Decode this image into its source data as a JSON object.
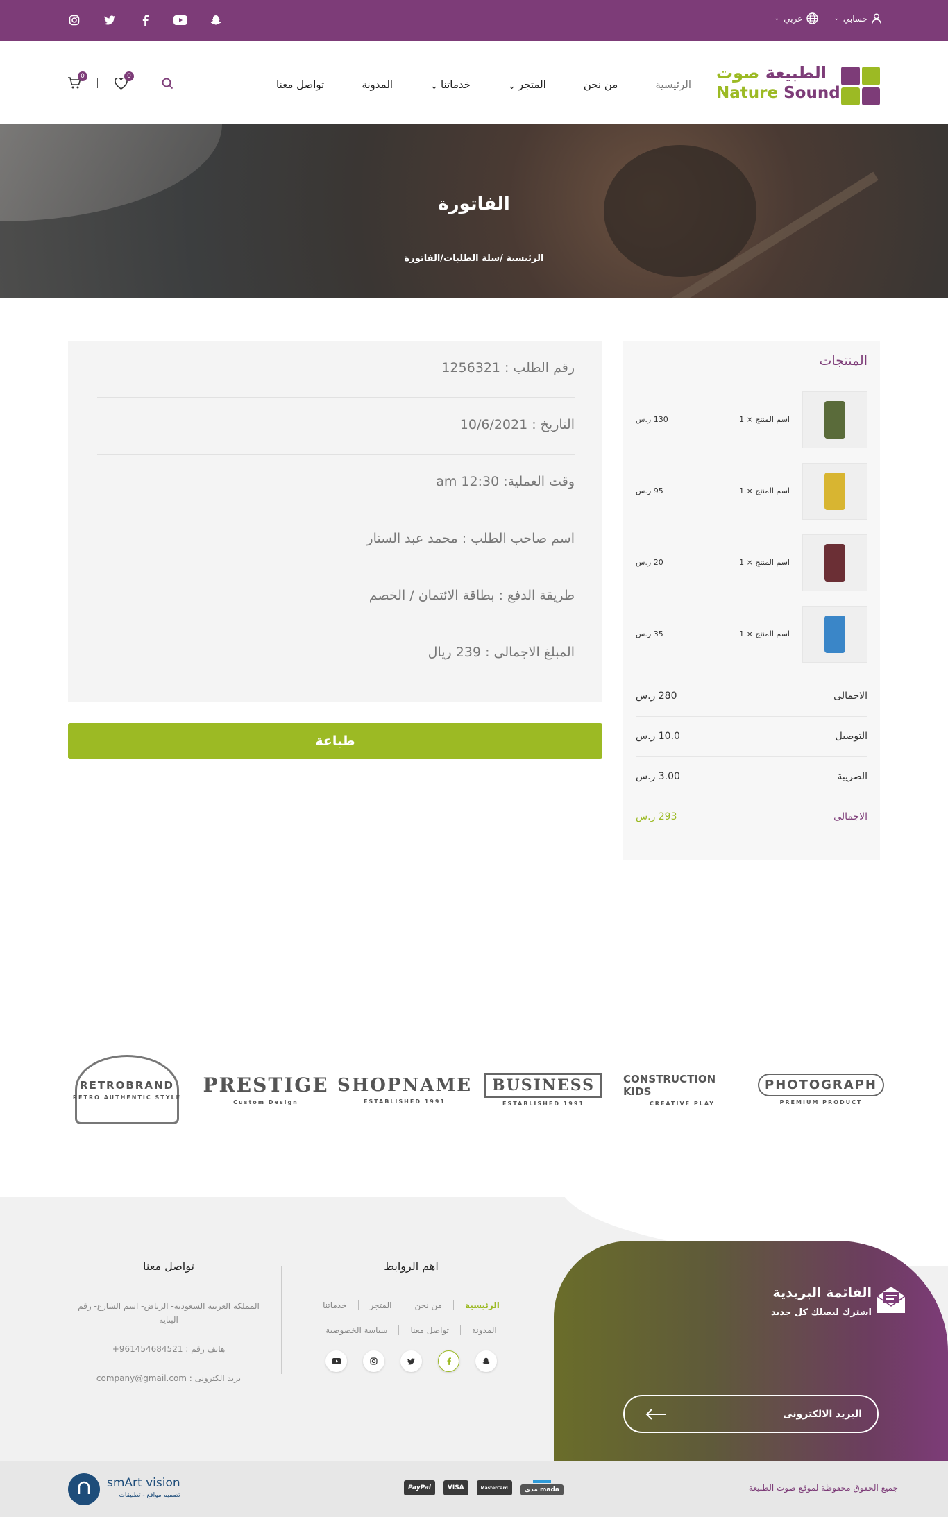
{
  "topbar": {
    "account": "حسابي",
    "language": "عربي",
    "social_icons": [
      "instagram-icon",
      "twitter-icon",
      "facebook-icon",
      "youtube-icon",
      "snapchat-icon"
    ]
  },
  "header": {
    "logo": {
      "arabic_part1": "صوت",
      "arabic_part2": "الطبيعة",
      "english_part1": "Nature",
      "english_part2": "Sound"
    },
    "nav": {
      "home": "الرئيسية",
      "about": "من نحن",
      "store": "المتجر",
      "services": "خدماتنا",
      "blog": "المدونة",
      "contact": "تواصل معنا"
    },
    "wishlist_count": "0",
    "cart_count": "0"
  },
  "hero": {
    "title": "الفاتورة",
    "breadcrumb": "الرئيسية /سلة الطلبات/الفاتورة"
  },
  "invoice": {
    "order_number": "رقم الطلب : 1256321",
    "date": "التاريخ : 10/6/2021",
    "time": "وقت العملية: 12:30 am",
    "customer": "اسم صاحب الطلب : محمد عبد الستار",
    "payment": "طريقة الدفع : بطاقة الائتمان / الخصم",
    "total": "المبلغ الاجمالى : 239 ريال",
    "print_label": "طباعة"
  },
  "products": {
    "title": "المنتجات",
    "items": [
      {
        "name": "اسم المنتج",
        "qty": "× 1",
        "price": "130 ر.س",
        "color": "#5a6b3a"
      },
      {
        "name": "اسم المنتج",
        "qty": "× 1",
        "price": "95 ر.س",
        "color": "#d8b531"
      },
      {
        "name": "اسم المنتج",
        "qty": "× 1",
        "price": "20 ر.س",
        "color": "#6b2f35"
      },
      {
        "name": "اسم المنتج",
        "qty": "× 1",
        "price": "35 ر.س",
        "color": "#3a86c8"
      }
    ],
    "totals": {
      "subtotal_label": "الاجمالى",
      "subtotal_value": "280   ر.س",
      "delivery_label": "التوصيل",
      "delivery_value": "10.0   ر.س",
      "tax_label": "الضريبة",
      "tax_value": "3.00   ر.س",
      "total_label": "الاجمالى",
      "total_value": "293 ر.س"
    }
  },
  "brands": [
    {
      "name": "RETROBRAND",
      "sub": "RETRO AUTHENTIC STYLE"
    },
    {
      "name": "PRESTIGE",
      "sub": "Custom Design"
    },
    {
      "name": "SHOPNAME",
      "sub": "ESTABLISHED 1991"
    },
    {
      "name": "BUSINESS",
      "sub": "ESTABLISHED 1991"
    },
    {
      "name": "CONSTRUCTION KIDS",
      "sub": "CREATIVE PLAY"
    },
    {
      "name": "PHOTOGRAPH",
      "sub": "PREMIUM PRODUCT"
    }
  ],
  "footer": {
    "newsletter_title": "القائمة البريدية",
    "newsletter_sub": "اشترك ليصلك كل جديد",
    "email_placeholder": "البريد الالكترونى",
    "links_title": "اهم الروابط",
    "links_row1": [
      "الرئيسية",
      "من نحن",
      "المتجر",
      "خدماتنا"
    ],
    "links_row2": [
      "المدونة",
      "تواصل معنا",
      "سياسة الخصوصية"
    ],
    "contact_title": "تواصل معنا",
    "address": "المملكة العربية السعودية- الرياض- اسم الشارع- رقم البناية",
    "phone": "هاتف رقم : 961454684521+",
    "email": "بريد الكترونى : company@gmail.com",
    "copyright": "جميع الحقوق محفوظة لموقع صوت الطبيعة",
    "payments": [
      "PayPal",
      "VISA",
      "MasterCard",
      "مدى mada"
    ],
    "credit_name": "smArt vision",
    "credit_sub": "تصميم مواقع - تطبيقات"
  },
  "colors": {
    "primary": "#7d3c78",
    "accent": "#9cba24"
  }
}
